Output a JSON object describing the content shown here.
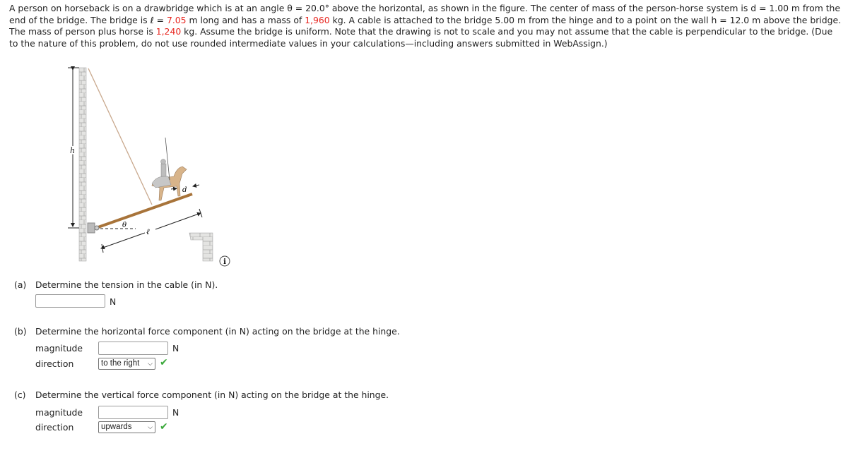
{
  "problem": {
    "intro_1": "A person on horseback is on a drawbridge which is at an angle θ = 20.0° above the horizontal, as shown in the figure. The center of mass of the person-horse system is d = 1.00 m from the end of the bridge. The bridge is ℓ = ",
    "length": "7.05",
    "intro_2": " m long and has a mass of ",
    "bridge_mass": "1,960",
    "intro_3": " kg. A cable is attached to the bridge 5.00 m from the hinge and to a point on the wall h = 12.0 m above the bridge. The mass of person plus horse is ",
    "rider_mass": "1,240",
    "intro_4": " kg. Assume the bridge is uniform. Note that the drawing is not to scale and you may not assume that the cable is perpendicular to the bridge. (Due to the nature of this problem, do not use rounded intermediate values in your calculations—including answers submitted in WebAssign.)"
  },
  "figure": {
    "h_label": "h",
    "d_label": "d",
    "theta_label": "θ",
    "l_label": "ℓ",
    "info_icon": "i"
  },
  "part_a": {
    "label": "(a)",
    "question": "Determine the tension in the cable (in N).",
    "value": "",
    "unit": "N"
  },
  "part_b": {
    "label": "(b)",
    "question": "Determine the horizontal force component (in N) acting on the bridge at the hinge.",
    "magnitude_label": "magnitude",
    "value": "",
    "unit": "N",
    "direction_label": "direction",
    "direction": "to the right"
  },
  "part_c": {
    "label": "(c)",
    "question": "Determine the vertical force component (in N) acting on the bridge at the hinge.",
    "magnitude_label": "magnitude",
    "value": "",
    "unit": "N",
    "direction_label": "direction",
    "direction": "upwards"
  },
  "colors": {
    "highlight": "#e8251f",
    "check": "#3aa83a"
  }
}
